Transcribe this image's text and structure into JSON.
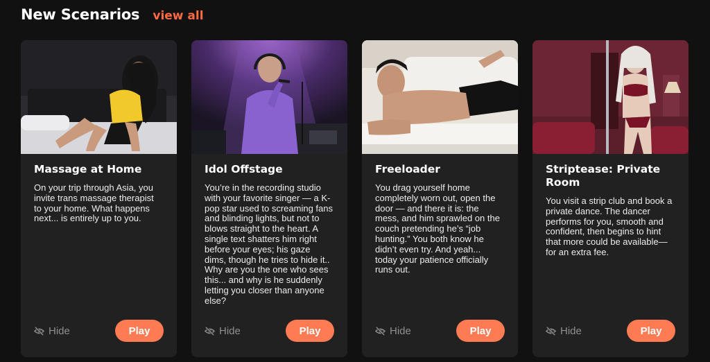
{
  "section": {
    "title": "New Scenarios",
    "view_all_label": "view all"
  },
  "colors": {
    "accent": "#fe6a42",
    "play_button": "#fe7b54",
    "card_background": "#212121",
    "page_background": "#111111"
  },
  "cards": [
    {
      "title": "Massage at Home",
      "description": "On your trip through Asia, you invite trans massage therapist to your home. What happens next... is entirely up to you.",
      "hide_label": "Hide",
      "play_label": "Play",
      "image_icon": "photo-woman-yellow-top-bed"
    },
    {
      "title": "Idol Offstage",
      "description": "You’re in the recording studio with your favorite singer — a K-pop star used to screaming fans and blinding lights, but not to blows straight to the heart. A single text shatters him right before your eyes; his gaze dims, though he tries to hide it.. Why are you the one who sees this... and why is he suddenly letting you closer than anyone else?",
      "hide_label": "Hide",
      "play_label": "Play",
      "image_icon": "photo-singer-purple-studio"
    },
    {
      "title": "Freeloader",
      "description": "You drag yourself home completely worn out, open the door — and there it is: the mess, and him sprawled on the couch pretending he’s “job hunting.” You both know he didn’t even try. And yeah... today your patience officially runs out.",
      "hide_label": "Hide",
      "play_label": "Play",
      "image_icon": "photo-man-lying-couch"
    },
    {
      "title": "Striptease: Private Room",
      "description": "You visit a strip club and book a private dance. The dancer performs for you, smooth and confident, then begins to hint that more could be available—for an extra fee.",
      "hide_label": "Hide",
      "play_label": "Play",
      "image_icon": "photo-dancer-red-room"
    }
  ]
}
